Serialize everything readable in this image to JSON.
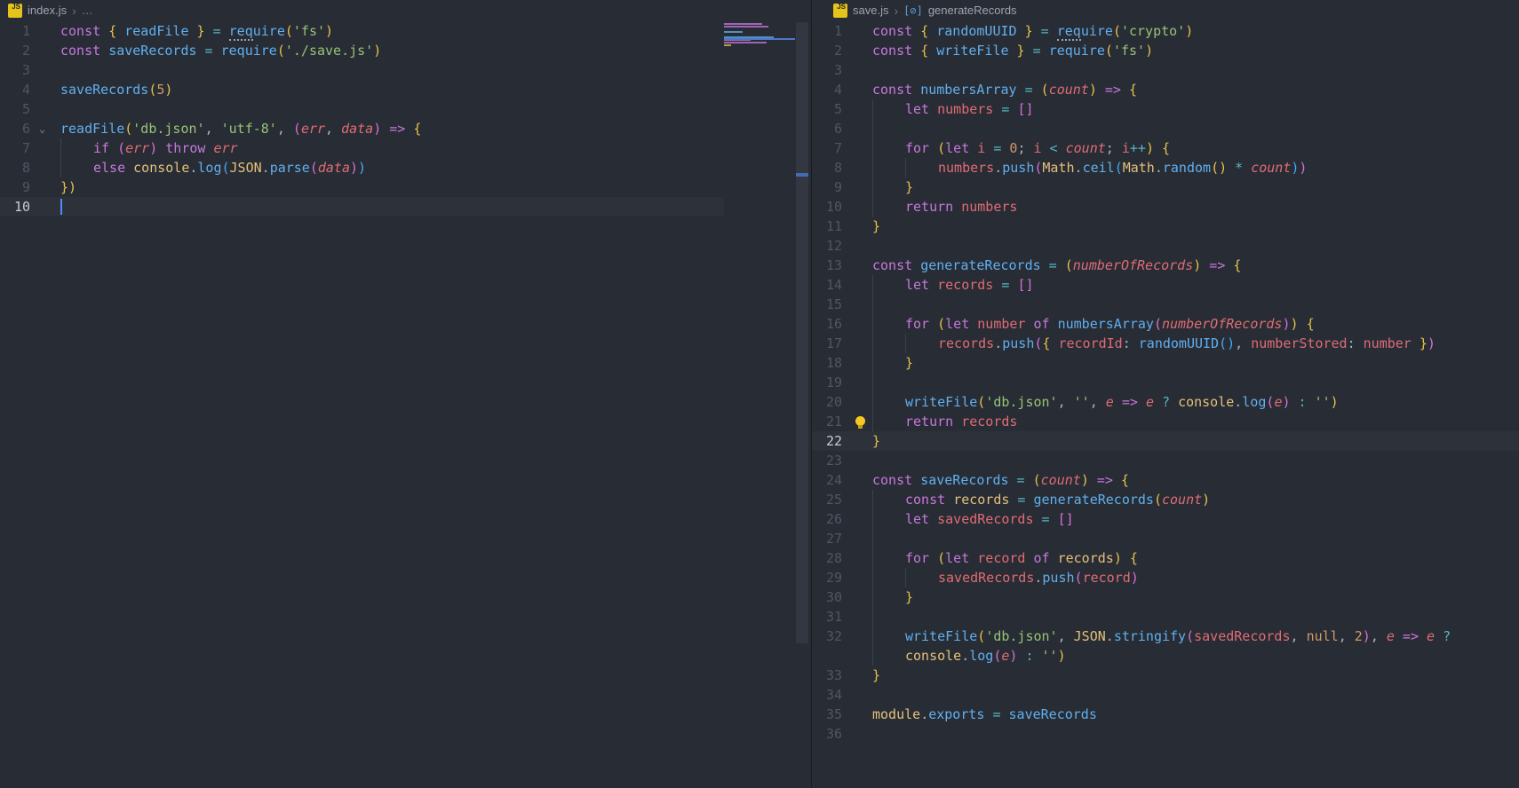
{
  "palette": {
    "editor_bg": "#282c34",
    "current_line": "#2c313a",
    "cursor": "#528bff",
    "keyword": "#c678dd",
    "function": "#61afef",
    "variable": "#e06c75",
    "constant": "#e5c07b",
    "string": "#98c379",
    "number": "#d19a66",
    "operator": "#56b6c2",
    "bracket_gold": "#e8c24a",
    "bracket_purple": "#d670d6",
    "bracket_blue": "#45a9f9",
    "line_number": "#4f5666",
    "line_number_active": "#c6ccd6",
    "js_icon_bg": "#e7c41a",
    "lightbulb": "#f6c821",
    "minimap_marker": "#4e77c7"
  },
  "left": {
    "breadcrumb": {
      "file": "index.js",
      "sep": "›",
      "tail": "…"
    },
    "file_icon": "js-file-icon",
    "lines": [
      {
        "n": "1",
        "ind": 0,
        "seg": [
          [
            "k",
            "const "
          ],
          [
            "bg",
            "{ "
          ],
          [
            "f",
            "readFile"
          ],
          [
            "bg",
            " }"
          ],
          [
            "o",
            " = "
          ],
          [
            "fu",
            "req"
          ],
          [
            "f",
            "uire"
          ],
          [
            "bg",
            "("
          ],
          [
            "s",
            "'fs'"
          ],
          [
            "bg",
            ")"
          ]
        ]
      },
      {
        "n": "2",
        "ind": 0,
        "seg": [
          [
            "k",
            "const "
          ],
          [
            "f",
            "saveRecords"
          ],
          [
            "o",
            " = "
          ],
          [
            "f",
            "require"
          ],
          [
            "bg",
            "("
          ],
          [
            "s",
            "'./save.js'"
          ],
          [
            "bg",
            ")"
          ]
        ]
      },
      {
        "n": "3",
        "ind": 0,
        "seg": []
      },
      {
        "n": "4",
        "ind": 0,
        "seg": [
          [
            "f",
            "saveRecords"
          ],
          [
            "bg",
            "("
          ],
          [
            "n",
            "5"
          ],
          [
            "bg",
            ")"
          ]
        ]
      },
      {
        "n": "5",
        "ind": 0,
        "seg": []
      },
      {
        "n": "6",
        "ind": 0,
        "chev": 1,
        "seg": [
          [
            "f",
            "readFile"
          ],
          [
            "bg",
            "("
          ],
          [
            "s",
            "'db.json'"
          ],
          [
            "p",
            ", "
          ],
          [
            "s",
            "'utf-8'"
          ],
          [
            "p",
            ", "
          ],
          [
            "bp",
            "("
          ],
          [
            "vi",
            "err"
          ],
          [
            "p",
            ", "
          ],
          [
            "vi",
            "data"
          ],
          [
            "bp",
            ")"
          ],
          [
            "k",
            " => "
          ],
          [
            "bg",
            "{"
          ]
        ]
      },
      {
        "n": "7",
        "ind": 1,
        "seg": [
          [
            "k",
            "if "
          ],
          [
            "bp",
            "("
          ],
          [
            "vi",
            "err"
          ],
          [
            "bp",
            ")"
          ],
          [
            "k",
            " throw "
          ],
          [
            "vi",
            "err"
          ]
        ]
      },
      {
        "n": "8",
        "ind": 1,
        "seg": [
          [
            "k",
            "else "
          ],
          [
            "c",
            "console"
          ],
          [
            "p",
            "."
          ],
          [
            "f",
            "log"
          ],
          [
            "bb",
            "("
          ],
          [
            "c",
            "JSON"
          ],
          [
            "p",
            "."
          ],
          [
            "f",
            "parse"
          ],
          [
            "bp",
            "("
          ],
          [
            "vi",
            "data"
          ],
          [
            "bp",
            ")"
          ],
          [
            "bb",
            ")"
          ]
        ]
      },
      {
        "n": "9",
        "ind": 0,
        "seg": [
          [
            "bg",
            "})"
          ]
        ]
      },
      {
        "n": "10",
        "ind": 0,
        "active": 1,
        "cur": 1,
        "seg": []
      }
    ]
  },
  "right": {
    "breadcrumb": {
      "file": "save.js",
      "sep": "›",
      "symbol_icon": "[⊘]",
      "symbol": "generateRecords"
    },
    "file_icon": "js-file-icon",
    "lines": [
      {
        "n": "1",
        "ind": 0,
        "seg": [
          [
            "k",
            "const "
          ],
          [
            "bg",
            "{ "
          ],
          [
            "f",
            "randomUUID"
          ],
          [
            "bg",
            " }"
          ],
          [
            "o",
            " = "
          ],
          [
            "fu",
            "req"
          ],
          [
            "f",
            "uire"
          ],
          [
            "bg",
            "("
          ],
          [
            "s",
            "'crypto'"
          ],
          [
            "bg",
            ")"
          ]
        ]
      },
      {
        "n": "2",
        "ind": 0,
        "seg": [
          [
            "k",
            "const "
          ],
          [
            "bg",
            "{ "
          ],
          [
            "f",
            "writeFile"
          ],
          [
            "bg",
            " }"
          ],
          [
            "o",
            " = "
          ],
          [
            "f",
            "require"
          ],
          [
            "bg",
            "("
          ],
          [
            "s",
            "'fs'"
          ],
          [
            "bg",
            ")"
          ]
        ]
      },
      {
        "n": "3",
        "ind": 0,
        "seg": []
      },
      {
        "n": "4",
        "ind": 0,
        "seg": [
          [
            "k",
            "const "
          ],
          [
            "f",
            "numbersArray"
          ],
          [
            "o",
            " = "
          ],
          [
            "bg",
            "("
          ],
          [
            "vi",
            "count"
          ],
          [
            "bg",
            ")"
          ],
          [
            "k",
            " => "
          ],
          [
            "bg",
            "{"
          ]
        ]
      },
      {
        "n": "5",
        "ind": 1,
        "seg": [
          [
            "k",
            "let "
          ],
          [
            "v",
            "numbers"
          ],
          [
            "o",
            " = "
          ],
          [
            "bp",
            "[]"
          ]
        ]
      },
      {
        "n": "6",
        "ind": 1,
        "seg": []
      },
      {
        "n": "7",
        "ind": 1,
        "seg": [
          [
            "k",
            "for "
          ],
          [
            "bg",
            "("
          ],
          [
            "k",
            "let "
          ],
          [
            "v",
            "i"
          ],
          [
            "o",
            " = "
          ],
          [
            "n",
            "0"
          ],
          [
            "p",
            "; "
          ],
          [
            "v",
            "i"
          ],
          [
            "o",
            " < "
          ],
          [
            "vi",
            "count"
          ],
          [
            "p",
            "; "
          ],
          [
            "v",
            "i"
          ],
          [
            "o",
            "++"
          ],
          [
            "bg",
            ")"
          ],
          [
            "p",
            " "
          ],
          [
            "bg",
            "{"
          ]
        ]
      },
      {
        "n": "8",
        "ind": 2,
        "seg": [
          [
            "v",
            "numbers"
          ],
          [
            "p",
            "."
          ],
          [
            "f",
            "push"
          ],
          [
            "bp",
            "("
          ],
          [
            "c",
            "Math"
          ],
          [
            "p",
            "."
          ],
          [
            "f",
            "ceil"
          ],
          [
            "bb",
            "("
          ],
          [
            "c",
            "Math"
          ],
          [
            "p",
            "."
          ],
          [
            "f",
            "random"
          ],
          [
            "bg",
            "()"
          ],
          [
            "o",
            " * "
          ],
          [
            "vi",
            "count"
          ],
          [
            "bb",
            ")"
          ],
          [
            "bp",
            ")"
          ]
        ]
      },
      {
        "n": "9",
        "ind": 1,
        "seg": [
          [
            "bg",
            "}"
          ]
        ]
      },
      {
        "n": "10",
        "ind": 1,
        "seg": [
          [
            "k",
            "return "
          ],
          [
            "v",
            "numbers"
          ]
        ]
      },
      {
        "n": "11",
        "ind": 0,
        "seg": [
          [
            "bg",
            "}"
          ]
        ]
      },
      {
        "n": "12",
        "ind": 0,
        "seg": []
      },
      {
        "n": "13",
        "ind": 0,
        "seg": [
          [
            "k",
            "const "
          ],
          [
            "f",
            "generateRecords"
          ],
          [
            "o",
            " = "
          ],
          [
            "bg",
            "("
          ],
          [
            "vi",
            "numberOfRecords"
          ],
          [
            "bg",
            ")"
          ],
          [
            "k",
            " => "
          ],
          [
            "bg",
            "{"
          ]
        ]
      },
      {
        "n": "14",
        "ind": 1,
        "seg": [
          [
            "k",
            "let "
          ],
          [
            "v",
            "records"
          ],
          [
            "o",
            " = "
          ],
          [
            "bp",
            "[]"
          ]
        ]
      },
      {
        "n": "15",
        "ind": 1,
        "seg": []
      },
      {
        "n": "16",
        "ind": 1,
        "seg": [
          [
            "k",
            "for "
          ],
          [
            "bg",
            "("
          ],
          [
            "k",
            "let "
          ],
          [
            "v",
            "number"
          ],
          [
            "k",
            " of "
          ],
          [
            "f",
            "numbersArray"
          ],
          [
            "bp",
            "("
          ],
          [
            "vi",
            "numberOfRecords"
          ],
          [
            "bp",
            ")"
          ],
          [
            "bg",
            ")"
          ],
          [
            "p",
            " "
          ],
          [
            "bg",
            "{"
          ]
        ]
      },
      {
        "n": "17",
        "ind": 2,
        "seg": [
          [
            "v",
            "records"
          ],
          [
            "p",
            "."
          ],
          [
            "f",
            "push"
          ],
          [
            "bp",
            "("
          ],
          [
            "bg",
            "{ "
          ],
          [
            "v",
            "recordId"
          ],
          [
            "p",
            ": "
          ],
          [
            "f",
            "randomUUID"
          ],
          [
            "bb",
            "()"
          ],
          [
            "p",
            ", "
          ],
          [
            "v",
            "numberStored"
          ],
          [
            "p",
            ": "
          ],
          [
            "v",
            "number"
          ],
          [
            "bg",
            " }"
          ],
          [
            "bp",
            ")"
          ]
        ]
      },
      {
        "n": "18",
        "ind": 1,
        "seg": [
          [
            "bg",
            "}"
          ]
        ]
      },
      {
        "n": "19",
        "ind": 1,
        "seg": []
      },
      {
        "n": "20",
        "ind": 1,
        "seg": [
          [
            "f",
            "writeFile"
          ],
          [
            "bg",
            "("
          ],
          [
            "s",
            "'db.json'"
          ],
          [
            "p",
            ", "
          ],
          [
            "s",
            "''"
          ],
          [
            "p",
            ", "
          ],
          [
            "vi",
            "e"
          ],
          [
            "k",
            " => "
          ],
          [
            "vi",
            "e"
          ],
          [
            "o",
            " ? "
          ],
          [
            "c",
            "console"
          ],
          [
            "p",
            "."
          ],
          [
            "f",
            "log"
          ],
          [
            "bp",
            "("
          ],
          [
            "vi",
            "e"
          ],
          [
            "bp",
            ")"
          ],
          [
            "o",
            " : "
          ],
          [
            "s",
            "''"
          ],
          [
            "bg",
            ")"
          ]
        ]
      },
      {
        "n": "21",
        "ind": 1,
        "bulb": 1,
        "seg": [
          [
            "k",
            "return "
          ],
          [
            "v",
            "records"
          ]
        ]
      },
      {
        "n": "22",
        "ind": 0,
        "active": 1,
        "seg": [
          [
            "bg",
            "}"
          ]
        ]
      },
      {
        "n": "23",
        "ind": 0,
        "seg": []
      },
      {
        "n": "24",
        "ind": 0,
        "seg": [
          [
            "k",
            "const "
          ],
          [
            "f",
            "saveRecords"
          ],
          [
            "o",
            " = "
          ],
          [
            "bg",
            "("
          ],
          [
            "vi",
            "count"
          ],
          [
            "bg",
            ")"
          ],
          [
            "k",
            " => "
          ],
          [
            "bg",
            "{"
          ]
        ]
      },
      {
        "n": "25",
        "ind": 1,
        "seg": [
          [
            "k",
            "const "
          ],
          [
            "c",
            "records"
          ],
          [
            "o",
            " = "
          ],
          [
            "f",
            "generateRecords"
          ],
          [
            "bg",
            "("
          ],
          [
            "vi",
            "count"
          ],
          [
            "bg",
            ")"
          ]
        ]
      },
      {
        "n": "26",
        "ind": 1,
        "seg": [
          [
            "k",
            "let "
          ],
          [
            "v",
            "savedRecords"
          ],
          [
            "o",
            " = "
          ],
          [
            "bp",
            "[]"
          ]
        ]
      },
      {
        "n": "27",
        "ind": 1,
        "seg": []
      },
      {
        "n": "28",
        "ind": 1,
        "seg": [
          [
            "k",
            "for "
          ],
          [
            "bg",
            "("
          ],
          [
            "k",
            "let "
          ],
          [
            "v",
            "record"
          ],
          [
            "k",
            " of "
          ],
          [
            "c",
            "records"
          ],
          [
            "bg",
            ")"
          ],
          [
            "p",
            " "
          ],
          [
            "bg",
            "{"
          ]
        ]
      },
      {
        "n": "29",
        "ind": 2,
        "seg": [
          [
            "v",
            "savedRecords"
          ],
          [
            "p",
            "."
          ],
          [
            "f",
            "push"
          ],
          [
            "bp",
            "("
          ],
          [
            "v",
            "record"
          ],
          [
            "bp",
            ")"
          ]
        ]
      },
      {
        "n": "30",
        "ind": 1,
        "seg": [
          [
            "bg",
            "}"
          ]
        ]
      },
      {
        "n": "31",
        "ind": 1,
        "seg": []
      },
      {
        "n": "32",
        "ind": 1,
        "seg": [
          [
            "f",
            "writeFile"
          ],
          [
            "bg",
            "("
          ],
          [
            "s",
            "'db.json'"
          ],
          [
            "p",
            ", "
          ],
          [
            "c",
            "JSON"
          ],
          [
            "p",
            "."
          ],
          [
            "f",
            "stringify"
          ],
          [
            "bp",
            "("
          ],
          [
            "v",
            "savedRecords"
          ],
          [
            "p",
            ", "
          ],
          [
            "n",
            "null"
          ],
          [
            "p",
            ", "
          ],
          [
            "n",
            "2"
          ],
          [
            "bp",
            ")"
          ],
          [
            "p",
            ", "
          ],
          [
            "vi",
            "e"
          ],
          [
            "k",
            " => "
          ],
          [
            "vi",
            "e"
          ],
          [
            "o",
            " ?"
          ]
        ]
      },
      {
        "n": "",
        "ind": 1,
        "wrap": 1,
        "seg": [
          [
            "c",
            "console"
          ],
          [
            "p",
            "."
          ],
          [
            "f",
            "log"
          ],
          [
            "bp",
            "("
          ],
          [
            "vi",
            "e"
          ],
          [
            "bp",
            ")"
          ],
          [
            "o",
            " : "
          ],
          [
            "s",
            "''"
          ],
          [
            "bg",
            ")"
          ]
        ]
      },
      {
        "n": "33",
        "ind": 0,
        "seg": [
          [
            "bg",
            "}"
          ]
        ]
      },
      {
        "n": "34",
        "ind": 0,
        "seg": []
      },
      {
        "n": "35",
        "ind": 0,
        "seg": [
          [
            "c",
            "module"
          ],
          [
            "p",
            "."
          ],
          [
            "f",
            "exports"
          ],
          [
            "o",
            " = "
          ],
          [
            "f",
            "saveRecords"
          ]
        ]
      },
      {
        "n": "36",
        "ind": 0,
        "seg": []
      }
    ]
  }
}
